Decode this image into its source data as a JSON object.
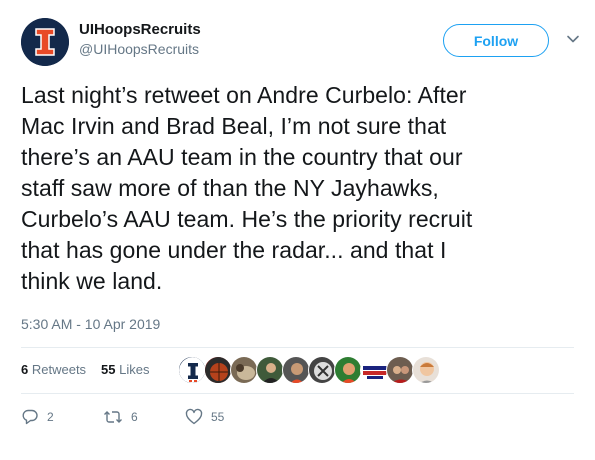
{
  "user": {
    "display_name": "UIHoopsRecruits",
    "handle": "@UIHoopsRecruits",
    "follow_label": "Follow"
  },
  "tweet": {
    "text": "Last night’s retweet on Andre Curbelo: After\nMac Irvin and Brad Beal, I’m not sure that\nthere’s an AAU team in the country that our\nstaff saw more of than the NY Jayhawks,\nCurbelo’s AAU team. He’s the priority recruit\nthat has gone under the radar... and that I\nthink we land.",
    "timestamp": "5:30 AM - 10 Apr 2019"
  },
  "stats": {
    "retweets_count": "6",
    "retweets_label": "Retweets",
    "likes_count": "55",
    "likes_label": "Likes"
  },
  "actions": {
    "reply_count": "2",
    "retweet_count": "6",
    "like_count": "55"
  },
  "colors": {
    "accent": "#1da1f2",
    "text_primary": "#14171a",
    "text_secondary": "#657786",
    "illini_orange": "#e84a27",
    "illini_blue": "#13294b"
  },
  "icons": {
    "reply": "reply-icon",
    "retweet": "retweet-icon",
    "like": "heart-icon",
    "caret": "chevron-down-icon"
  }
}
